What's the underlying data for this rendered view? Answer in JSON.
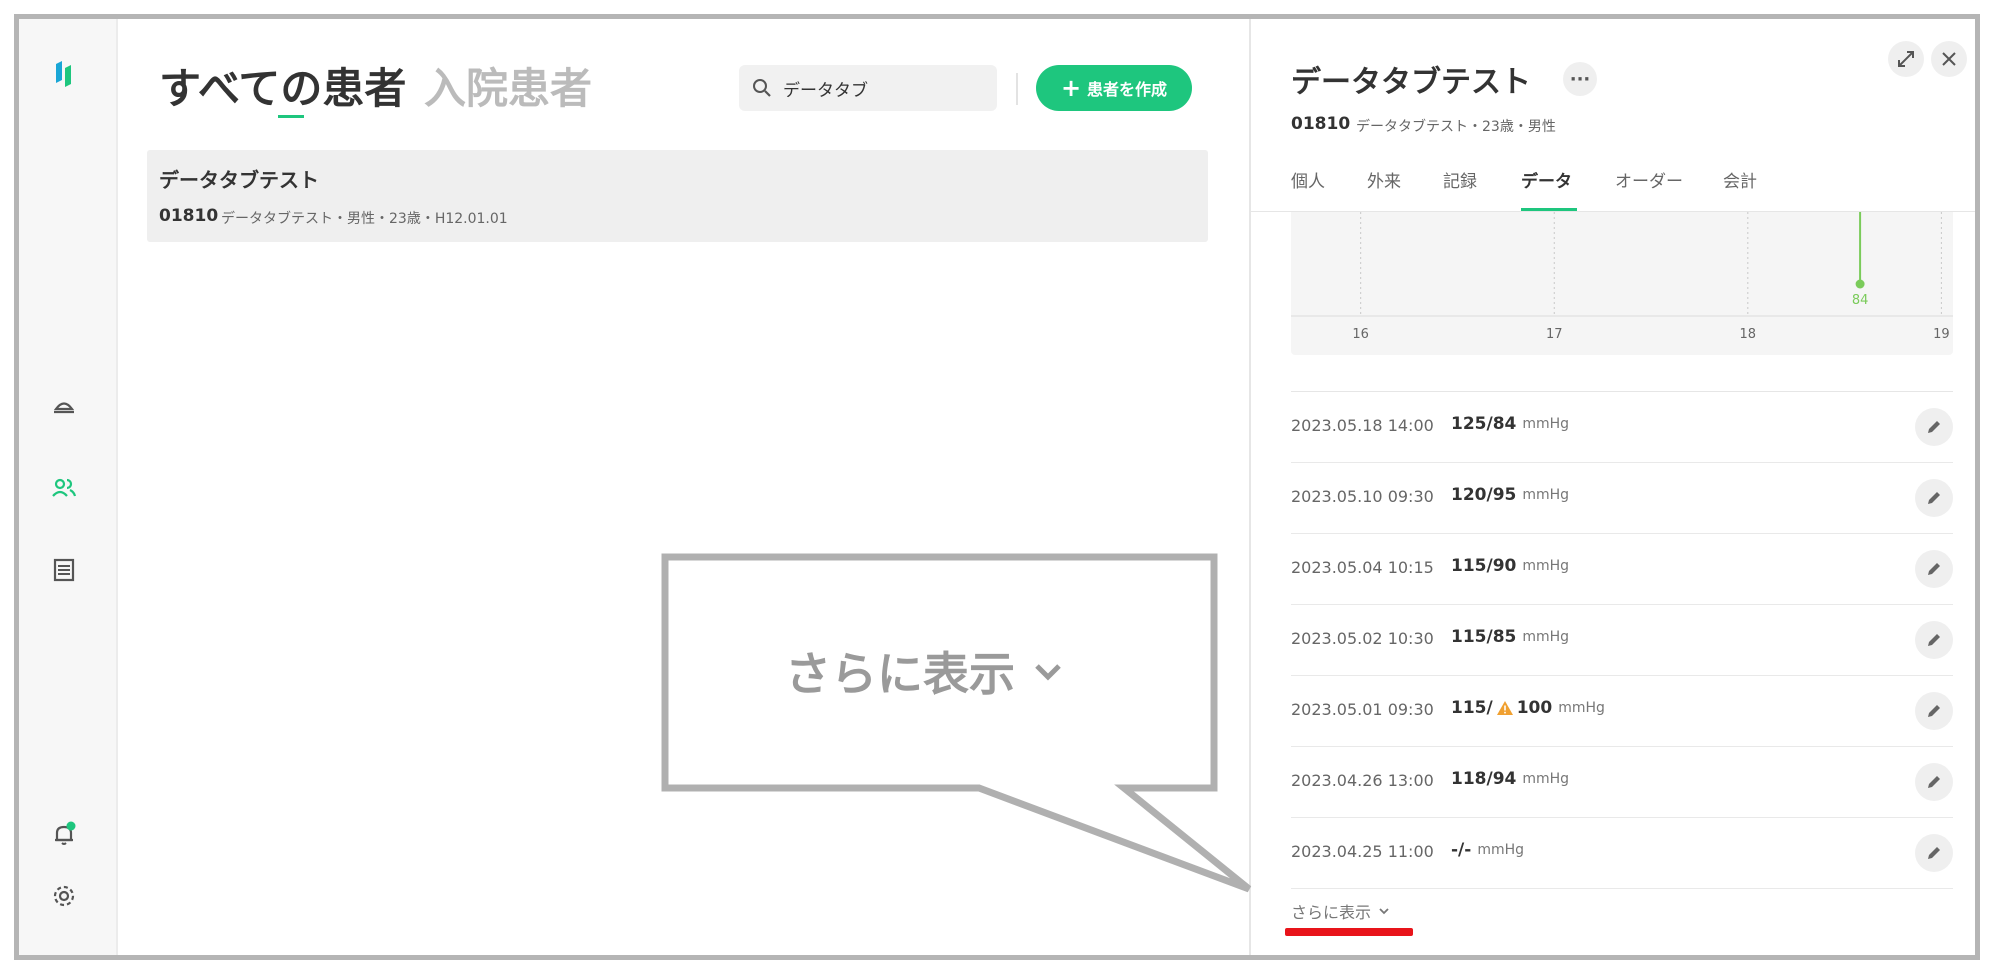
{
  "main": {
    "tab_all": "すべての患者",
    "tab_inpatient": "入院患者",
    "search_value": "データタブ",
    "create_button": "患者を作成",
    "patient": {
      "name": "データタブテスト",
      "id": "01810",
      "meta": "データタブテスト・男性・23歳・H12.01.01"
    }
  },
  "callout": {
    "text": "さらに表示"
  },
  "panel": {
    "title": "データタブテスト",
    "more": "···",
    "patient_id": "01810",
    "patient_meta": "データタブテスト・23歳・男性",
    "tabs": [
      "個人",
      "外来",
      "記録",
      "データ",
      "オーダー",
      "会計"
    ],
    "active_tab": "データ",
    "chart_data": {
      "type": "line",
      "x_ticks": [
        "16",
        "17",
        "18",
        "19"
      ],
      "points": [
        {
          "x": 18.58,
          "y": 84,
          "label": "84"
        }
      ],
      "color": "#7acb5a"
    },
    "records": [
      {
        "date": "2023.05.18 14:00",
        "value": "125/84",
        "unit": "mmHg",
        "warn": false
      },
      {
        "date": "2023.05.10 09:30",
        "value": "120/95",
        "unit": "mmHg",
        "warn": false
      },
      {
        "date": "2023.05.04 10:15",
        "value": "115/90",
        "unit": "mmHg",
        "warn": false
      },
      {
        "date": "2023.05.02 10:30",
        "value": "115/85",
        "unit": "mmHg",
        "warn": false
      },
      {
        "date": "2023.05.01 09:30",
        "value_pre": "115/",
        "value_post": "100",
        "unit": "mmHg",
        "warn": true
      },
      {
        "date": "2023.04.26 13:00",
        "value": "118/94",
        "unit": "mmHg",
        "warn": false
      },
      {
        "date": "2023.04.25 11:00",
        "value": "-/-",
        "unit": "mmHg",
        "warn": false
      }
    ],
    "show_more": "さらに表示"
  },
  "colors": {
    "accent": "#1ec67e",
    "highlight_underline": "#e8141a",
    "warning": "#f0a030"
  }
}
